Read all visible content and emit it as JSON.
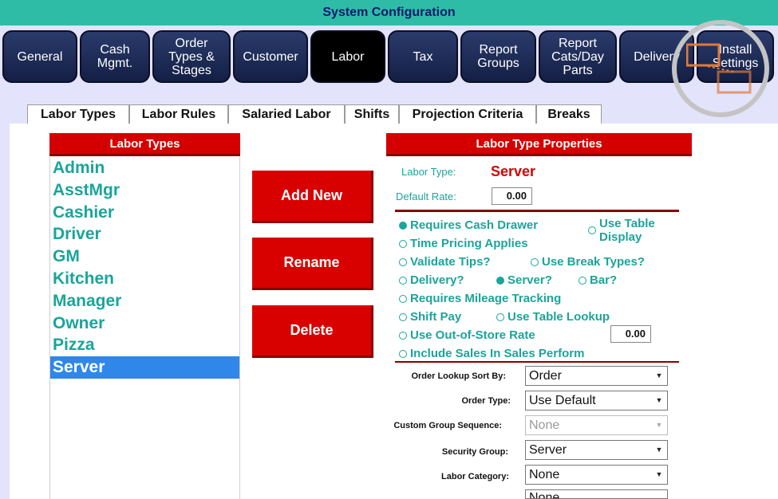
{
  "window": {
    "title": "System Configuration"
  },
  "main_tabs": [
    {
      "label": "General"
    },
    {
      "label": "Cash\nMgmt."
    },
    {
      "label": "Order\nTypes &\nStages"
    },
    {
      "label": "Customer"
    },
    {
      "label": "Labor"
    },
    {
      "label": "Tax"
    },
    {
      "label": "Report\nGroups"
    },
    {
      "label": "Report\nCats/Day\nParts"
    },
    {
      "label": "Delivery"
    },
    {
      "label": "Install\nSettings"
    }
  ],
  "sub_tabs": [
    {
      "label": "Labor Types"
    },
    {
      "label": "Labor Rules"
    },
    {
      "label": "Salaried Labor"
    },
    {
      "label": "Shifts"
    },
    {
      "label": "Projection Criteria"
    },
    {
      "label": "Breaks"
    }
  ],
  "labor_types": {
    "header": "Labor Types",
    "items": [
      "Admin",
      "AsstMgr",
      "Cashier",
      "Driver",
      "GM",
      "Kitchen",
      "Manager",
      "Owner",
      "Pizza",
      "Server"
    ],
    "selected": "Server"
  },
  "buttons": {
    "add_new": "Add New",
    "rename": "Rename",
    "delete": "Delete"
  },
  "properties": {
    "header": "Labor Type Properties",
    "labor_type_label": "Labor Type:",
    "labor_type_value": "Server",
    "default_rate_label": "Default Rate:",
    "default_rate_value": "0.00",
    "options": {
      "requires_cash_drawer": "Requires Cash Drawer",
      "use_table_display": "Use Table\nDisplay",
      "time_pricing": "Time Pricing Applies",
      "validate_tips": "Validate Tips?",
      "use_break_types": "Use Break Types?",
      "delivery": "Delivery?",
      "server": "Server?",
      "bar": "Bar?",
      "mileage": "Requires Mileage Tracking",
      "shift_pay": "Shift Pay",
      "use_table_lookup": "Use Table Lookup",
      "out_of_store": "Use Out-of-Store Rate",
      "out_of_store_value": "0.00",
      "include_sales": "Include Sales In Sales Perform"
    },
    "fields": {
      "order_lookup_sort_label": "Order Lookup Sort By:",
      "order_lookup_sort_value": "Order",
      "order_type_label": "Order Type:",
      "order_type_value": "Use Default",
      "custom_group_label": "Custom Group Sequence:",
      "custom_group_value": "None",
      "security_group_label": "Security Group:",
      "security_group_value": "Server",
      "labor_category_label": "Labor Category:",
      "labor_category_value": "None",
      "default_dept_value": "None"
    }
  },
  "colors": {
    "title_bar": "#2fbca6",
    "accent_red": "#d40000",
    "teal_text": "#1aa59a",
    "selection": "#2f87e9"
  }
}
